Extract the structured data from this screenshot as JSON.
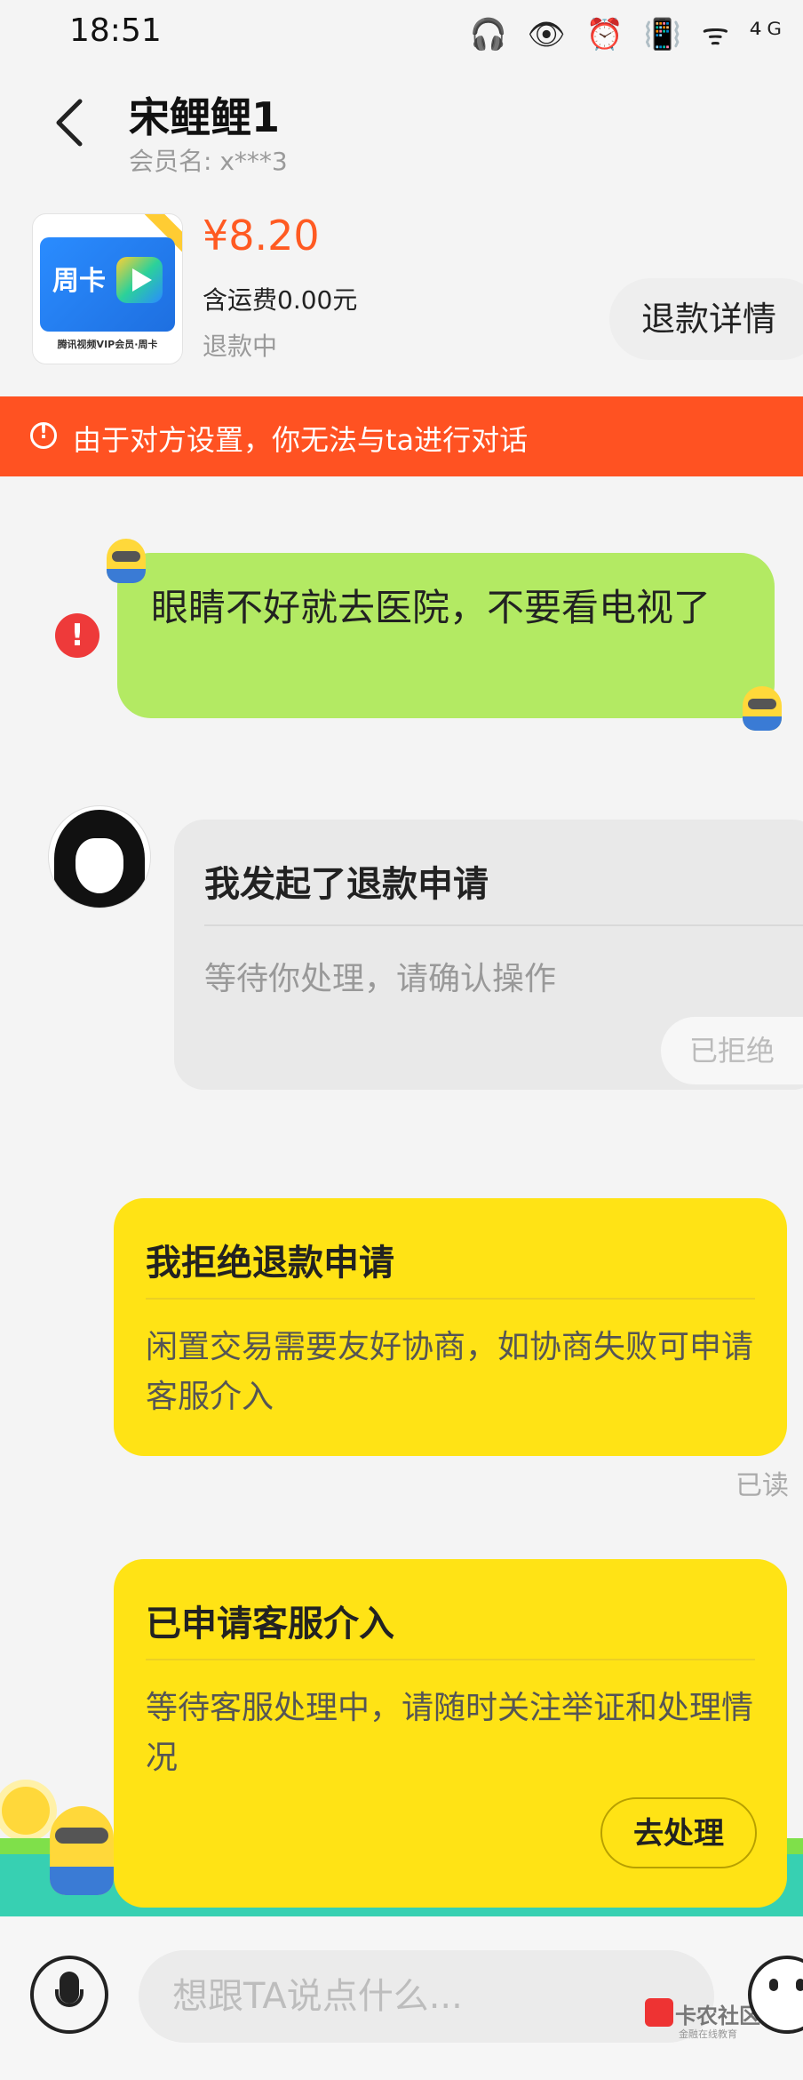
{
  "status_bar": {
    "time": "18:51",
    "icons": [
      "headphones-icon",
      "eye-icon",
      "alarm-icon",
      "vibrate-icon",
      "wifi-icon",
      "4g-signal-icon"
    ],
    "icons_text": "🎧 👁 ⏰ 📳 ᯤ ⁴ᴳ"
  },
  "header": {
    "title": "宋鲤鲤1",
    "member_label": "会员名:",
    "member_value": "x***3"
  },
  "product": {
    "thumb_week": "周卡",
    "thumb_caption": "腾讯视频VIP会员·周卡",
    "price": "¥8.20",
    "shipping": "含运费0.00元",
    "status": "退款中",
    "refund_detail_label": "退款详情"
  },
  "banner": {
    "text": "由于对方设置，你无法与ta进行对话",
    "color": "#ff5222"
  },
  "messages": {
    "own_text": "眼睛不好就去医院，不要看电视了",
    "refund_request": {
      "title": "我发起了退款申请",
      "body": "等待你处理，请确认操作",
      "button": "已拒绝"
    },
    "reject": {
      "title": "我拒绝退款申请",
      "body": "闲置交易需要友好协商，如协商失败可申请客服介入",
      "read_status": "已读"
    },
    "service": {
      "title": "已申请客服介入",
      "body": "等待客服处理中，请随时关注举证和处理情况",
      "button": "去处理"
    }
  },
  "input": {
    "placeholder": "想跟TA说点什么..."
  },
  "watermark": {
    "name": "卡农社区",
    "sub": "金融在线教育"
  },
  "colors": {
    "own_bubble": "#b3ea63",
    "card_yellow": "#ffe315",
    "price": "#ff5a22"
  }
}
